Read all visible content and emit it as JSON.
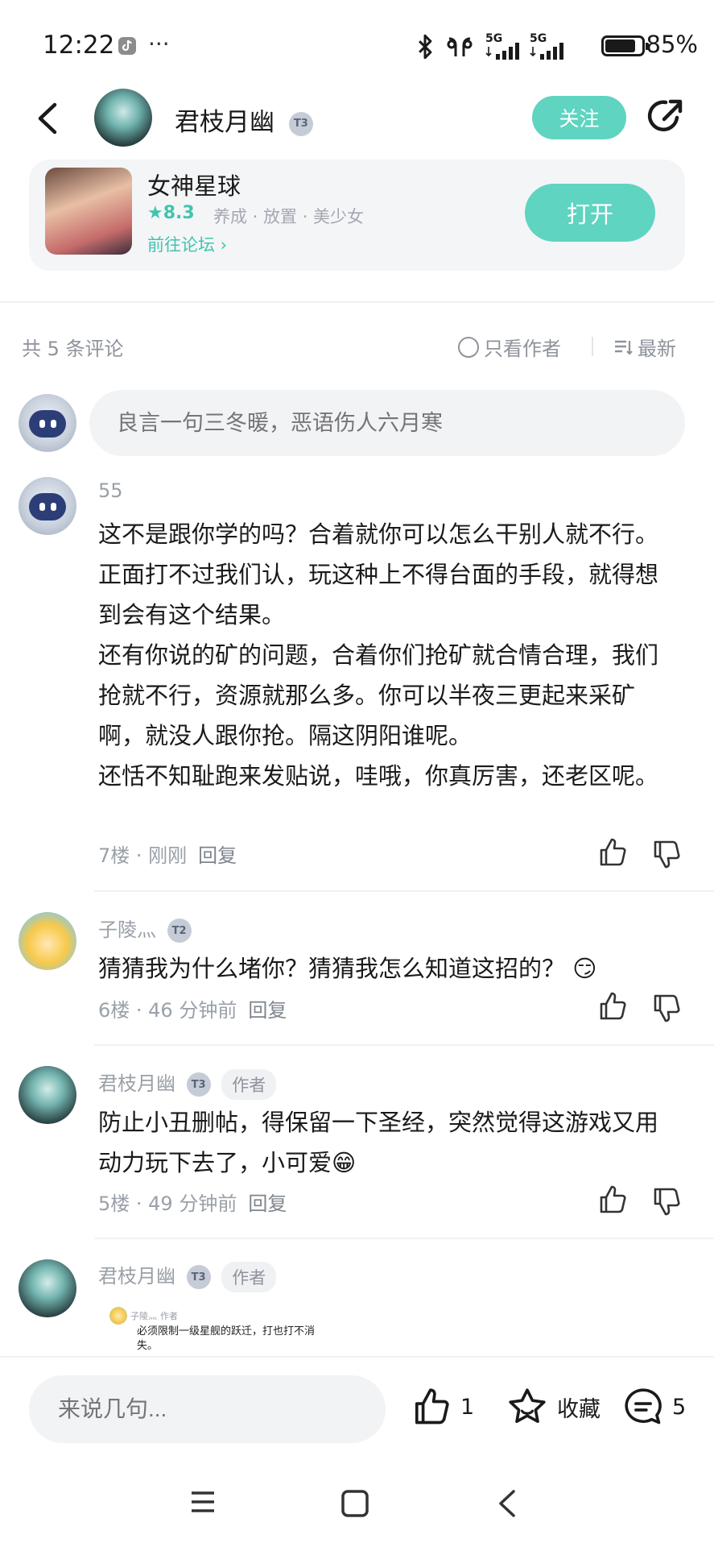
{
  "status_bar": {
    "time": "12:22",
    "more": "···",
    "net1": "5G",
    "net2": "5G",
    "battery_pct": "85%",
    "battery_level": 0.85
  },
  "header": {
    "username": "君枝月幽",
    "level": "T3",
    "follow_label": "关注"
  },
  "game_card": {
    "name": "女神星球",
    "rating": "★8.3",
    "tags": "养成 · 放置 · 美少女",
    "forum_link": "前往论坛 ›",
    "open_label": "打开"
  },
  "filter": {
    "count_text": "共 5 条评论",
    "only_author": "只看作者",
    "sort": "最新"
  },
  "comment_input": {
    "placeholder": "良言一句三冬暖，恶语伤人六月寒"
  },
  "comments": [
    {
      "user": "55",
      "paragraphs": [
        "这不是跟你学的吗？合着就你可以怎么干别人就不行。正面打不过我们认，玩这种上不得台面的手段，就得想到会有这个结果。",
        "还有你说的矿的问题，合着你们抢矿就合情合理，我们抢就不行，资源就那么多。你可以半夜三更起来采矿啊，就没人跟你抢。隔这阴阳谁呢。",
        "还恬不知耻跑来发贴说，哇哦，你真厉害，还老区呢。"
      ],
      "meta": "7楼 · 刚刚",
      "reply": "回复"
    },
    {
      "user": "子陵灬",
      "level": "T2",
      "text": "猜猜我为什么堵你？猜猜我怎么知道这招的？",
      "emoji": "😏",
      "meta": "6楼 · 46 分钟前",
      "reply": "回复"
    },
    {
      "user": "君枝月幽",
      "level": "T3",
      "badge": "作者",
      "text": "防止小丑删帖，得保留一下圣经，突然觉得这游戏又用动力玩下去了，小可爱",
      "emoji": "😁",
      "meta": "5楼 · 49 分钟前",
      "reply": "回复"
    },
    {
      "user": "君枝月幽",
      "level": "T3",
      "badge": "作者",
      "quote_user": "子陵灬",
      "quote_badge": "作者",
      "quote_text": "必须限制一级星舰的跃迁，打也打不消失。"
    }
  ],
  "bottom_bar": {
    "input_placeholder": "来说几句...",
    "like_count": "1",
    "favorite_label": "收藏",
    "comment_count": "5"
  }
}
